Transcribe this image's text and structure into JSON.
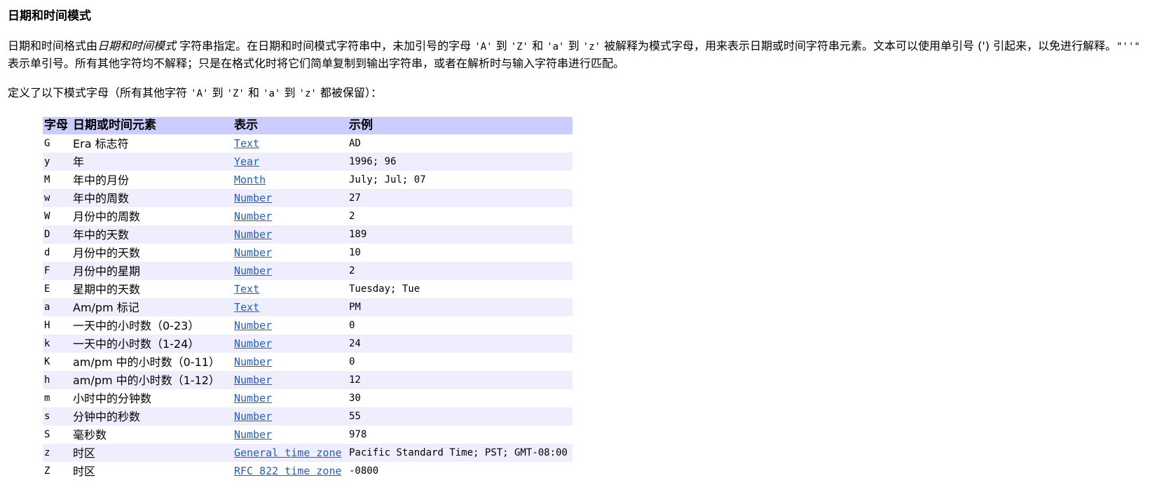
{
  "heading": "日期和时间模式",
  "intro": {
    "part1": "日期和时间格式由",
    "italic": "日期和时间模式",
    "part2": " 字符串指定。在日期和时间模式字符串中，未加引号的字母 ",
    "code_A": "'A'",
    "part3": " 到 ",
    "code_Z": "'Z'",
    "part4": " 和 ",
    "code_a": "'a'",
    "part5": " 到 ",
    "code_z": "'z'",
    "part6": " 被解释为模式字母，用来表示日期或时间字符串元素。文本可以使用单引号 (') 引起来，以免进行解释。",
    "code_quote": "\"''\"",
    "part7": " 表示单引号。所有其他字符均不解释；只是在格式化时将它们简单复制到输出字符串，或者在解析时与输入字符串进行匹配。"
  },
  "defined": {
    "part1": "定义了以下模式字母（所有其他字符 ",
    "code_A": "'A'",
    "part2": " 到 ",
    "code_Z": "'Z'",
    "part3": " 和 ",
    "code_a": "'a'",
    "part4": " 到 ",
    "code_z": "'z'",
    "part5": " 都被保留）："
  },
  "table": {
    "headers": [
      "字母",
      "日期或时间元素",
      "表示",
      "示例"
    ],
    "rows": [
      {
        "letter": "G",
        "element": "Era 标志符",
        "presentation": "Text",
        "example": "AD"
      },
      {
        "letter": "y",
        "element": "年",
        "presentation": "Year",
        "example": "1996; 96"
      },
      {
        "letter": "M",
        "element": "年中的月份",
        "presentation": "Month",
        "example": "July; Jul; 07"
      },
      {
        "letter": "w",
        "element": "年中的周数",
        "presentation": "Number",
        "example": "27"
      },
      {
        "letter": "W",
        "element": "月份中的周数",
        "presentation": "Number",
        "example": "2"
      },
      {
        "letter": "D",
        "element": "年中的天数",
        "presentation": "Number",
        "example": "189"
      },
      {
        "letter": "d",
        "element": "月份中的天数",
        "presentation": "Number",
        "example": "10"
      },
      {
        "letter": "F",
        "element": "月份中的星期",
        "presentation": "Number",
        "example": "2"
      },
      {
        "letter": "E",
        "element": "星期中的天数",
        "presentation": "Text",
        "example": "Tuesday; Tue"
      },
      {
        "letter": "a",
        "element": "Am/pm 标记",
        "presentation": "Text",
        "example": "PM"
      },
      {
        "letter": "H",
        "element": "一天中的小时数（0-23）",
        "presentation": "Number",
        "example": "0"
      },
      {
        "letter": "k",
        "element": "一天中的小时数（1-24）",
        "presentation": "Number",
        "example": "24"
      },
      {
        "letter": "K",
        "element": "am/pm 中的小时数（0-11）",
        "presentation": "Number",
        "example": "0"
      },
      {
        "letter": "h",
        "element": "am/pm 中的小时数（1-12）",
        "presentation": "Number",
        "example": "12"
      },
      {
        "letter": "m",
        "element": "小时中的分钟数",
        "presentation": "Number",
        "example": "30"
      },
      {
        "letter": "s",
        "element": "分钟中的秒数",
        "presentation": "Number",
        "example": "55"
      },
      {
        "letter": "S",
        "element": "毫秒数",
        "presentation": "Number",
        "example": "978"
      },
      {
        "letter": "z",
        "element": "时区",
        "presentation": "General time zone",
        "example": "Pacific Standard Time; PST; GMT-08:00"
      },
      {
        "letter": "Z",
        "element": "时区",
        "presentation": "RFC 822 time zone",
        "example": "-0800"
      }
    ]
  },
  "colors": {
    "header_bg": "#ccccff",
    "odd_row_bg": "#eeeeff",
    "even_row_bg": "#ffffff",
    "link": "#1f5fbf"
  }
}
